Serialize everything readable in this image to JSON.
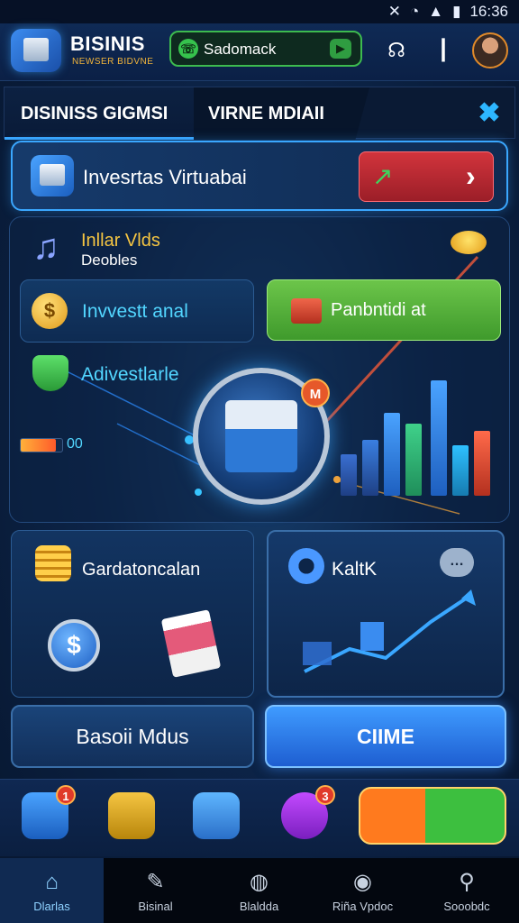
{
  "status_bar": {
    "time": "16:36"
  },
  "header": {
    "brand_title": "BISINIS",
    "brand_subtitle": "NEWSER BIDVNE",
    "search_label": "Sadomack"
  },
  "tabs": [
    {
      "label": "DISINISS GIGMSI"
    },
    {
      "label": "VIRNE MDIAII"
    }
  ],
  "banner": {
    "label": "Invesrtas Virtuabai"
  },
  "main": {
    "vids_title": "Inllar Vlds",
    "vids_subtitle": "Deobles",
    "invest_label": "Invvestt anal",
    "partner_label": "Panbntidi at",
    "advert_label": "Adivestlarle",
    "progress_text": "00",
    "progress_value": 0.85,
    "hub_badge": "M"
  },
  "cards": {
    "calc_label": "Gardatoncalan",
    "kalk_label": "KaltK"
  },
  "buttons": {
    "basic_label": "Basoii Mdus",
    "clime_label": "CIIME"
  },
  "dock": {
    "badge_1": "1",
    "badge_2": "3"
  },
  "nav": [
    {
      "label": "Dlarlas",
      "icon": "home-icon"
    },
    {
      "label": "Bisinal",
      "icon": "pen-icon"
    },
    {
      "label": "Blaldda",
      "icon": "lock-icon"
    },
    {
      "label": "Riña Vpdoc",
      "icon": "apple-icon"
    },
    {
      "label": "Sooobdc",
      "icon": "bell-icon"
    }
  ],
  "colors": {
    "accent": "#3aa7ff",
    "green": "#3dbf3f",
    "red": "#d2343c",
    "gold": "#f5c542"
  }
}
